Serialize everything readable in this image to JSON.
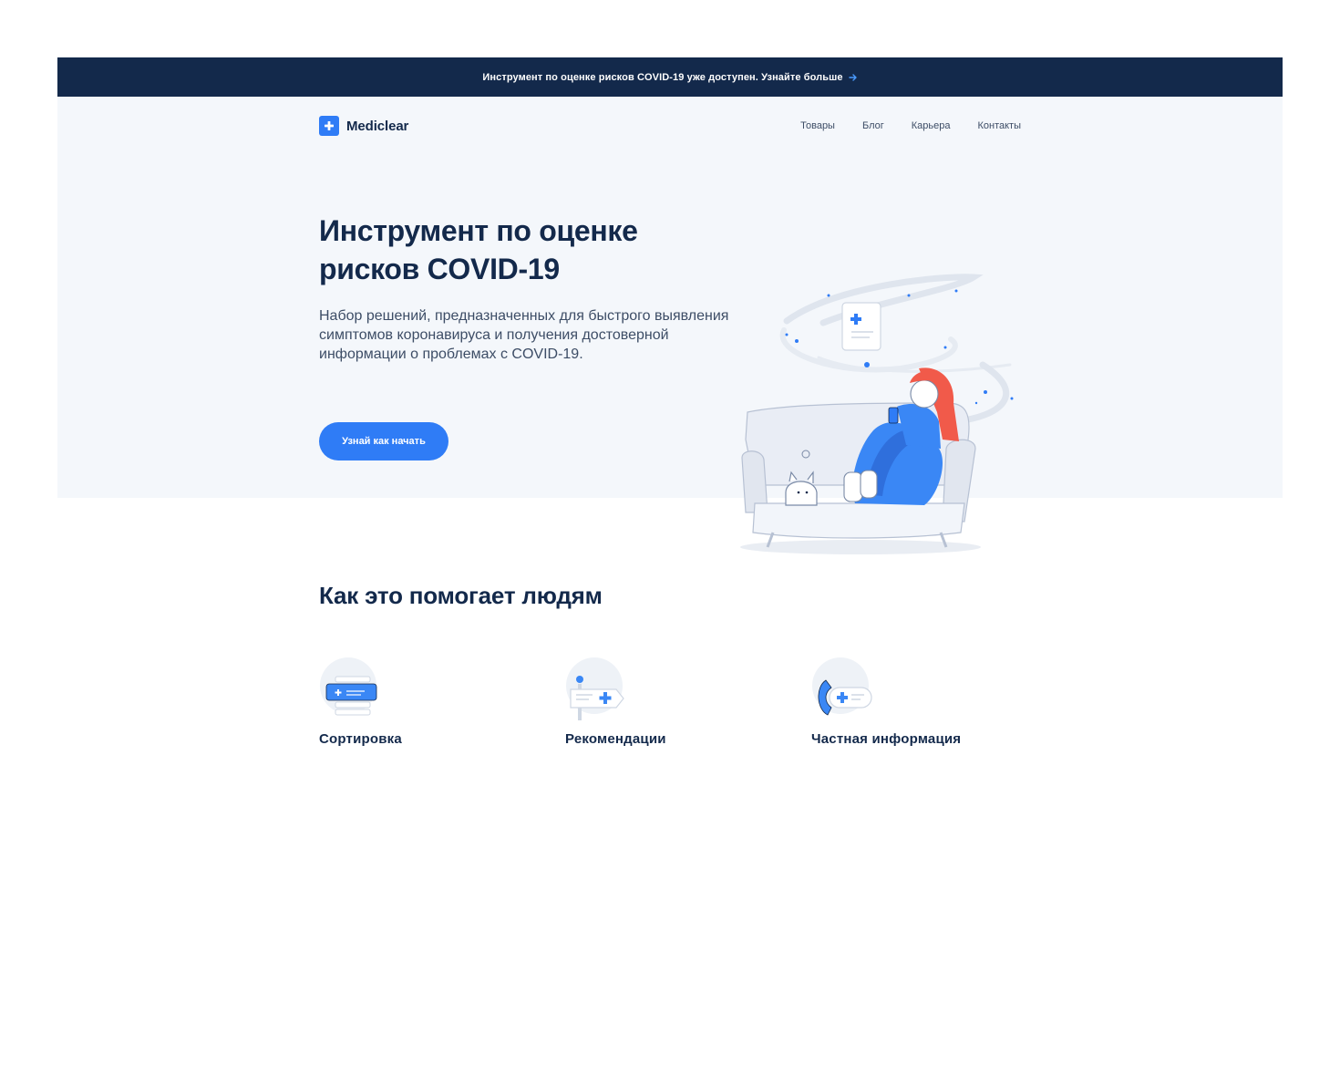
{
  "announcement": {
    "text": "Инструмент по оценке рисков COVID-19 уже доступен. Узнайте больше",
    "arrow_icon": "arrow-right-icon"
  },
  "brand": {
    "name": "Mediclear",
    "logo_icon": "medical-cross-icon",
    "accent_color": "#2f7cf6",
    "dark_color": "#13294b"
  },
  "nav": {
    "items": [
      {
        "label": "Товары"
      },
      {
        "label": "Блог"
      },
      {
        "label": "Карьера"
      },
      {
        "label": "Контакты"
      }
    ]
  },
  "hero": {
    "title": "Инструмент по оценке рисков COVID-19",
    "subtitle": "Набор решений, предназначенных для быстрого выявления симптомов коронавируса и получения достоверной информации о проблемах с COVID-19.",
    "cta_label": "Узнай как начать",
    "illustration_icon": "woman-on-sofa-illustration"
  },
  "helps": {
    "title": "Как это помогает людям",
    "items": [
      {
        "label": "Сортировка",
        "icon": "triage-card-icon"
      },
      {
        "label": "Рекомендации",
        "icon": "recommendation-sign-icon"
      },
      {
        "label": "Частная информация",
        "icon": "phone-info-icon"
      }
    ]
  }
}
